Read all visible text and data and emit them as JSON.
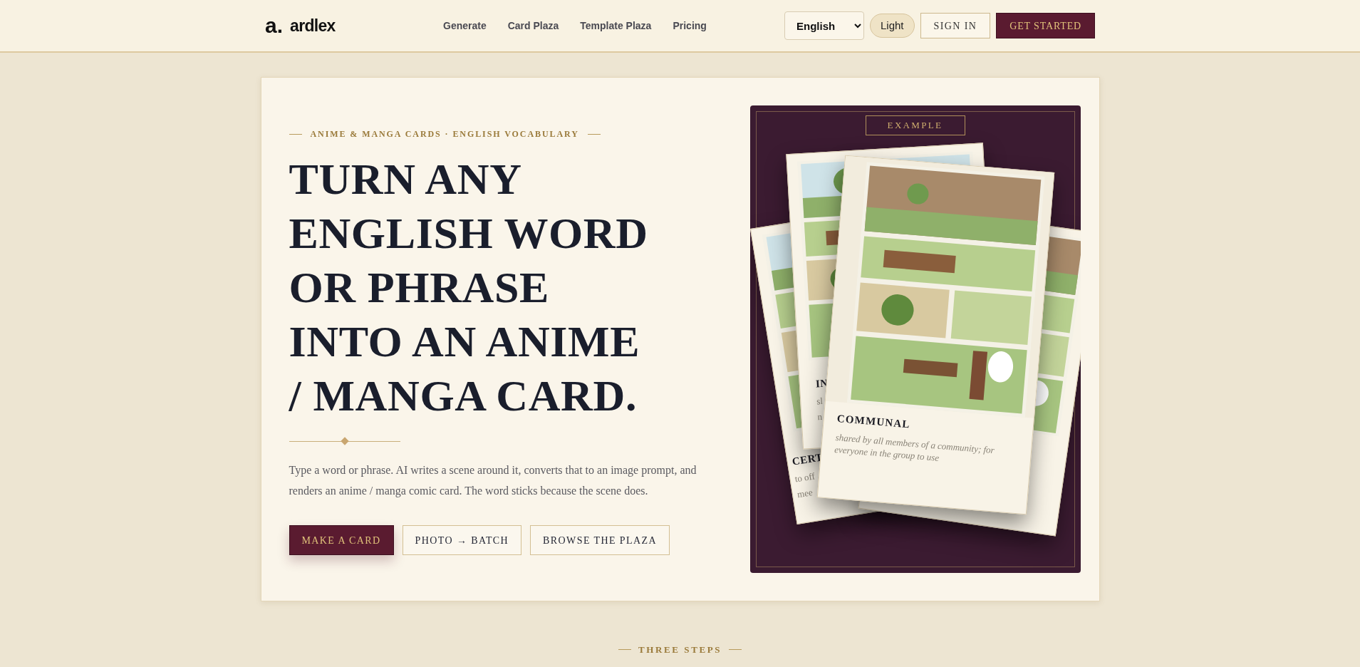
{
  "header": {
    "logo_mark": "a.",
    "logo_text": "ardlex",
    "nav": [
      {
        "label": "Generate"
      },
      {
        "label": "Card Plaza"
      },
      {
        "label": "Template Plaza"
      },
      {
        "label": "Pricing"
      }
    ],
    "language": "English",
    "theme_toggle": "Light",
    "sign_in": "SIGN IN",
    "get_started": "GET STARTED"
  },
  "hero": {
    "eyebrow": "ANIME & MANGA CARDS · ENGLISH VOCABULARY",
    "headline_lines": [
      "TURN ANY",
      "ENGLISH WORD",
      "OR PHRASE",
      "INTO AN ANIME",
      "/ MANGA CARD."
    ],
    "description": "Type a word or phrase. AI writes a scene around it, converts that to an image prompt, and renders an anime / manga comic card. The word sticks because the scene does.",
    "buttons": [
      {
        "label": "MAKE A CARD",
        "kind": "primary"
      },
      {
        "label": "PHOTO → BATCH",
        "kind": "outline"
      },
      {
        "label": "BROWSE THE PLAZA",
        "kind": "outline"
      }
    ]
  },
  "example": {
    "badge": "EXAMPLE",
    "cards": [
      {
        "kind": "back-left",
        "word": "CERT",
        "definition_lines": [
          "to off",
          "mee"
        ]
      },
      {
        "kind": "back-right"
      },
      {
        "kind": "back-middle",
        "word": "IN",
        "definition_lines": [
          "sl",
          "n"
        ]
      },
      {
        "kind": "front",
        "word": "COMMUNAL",
        "definition": "shared by all members of a community; for everyone in the group to use"
      }
    ]
  },
  "next_section": {
    "eyebrow": "THREE STEPS"
  }
}
